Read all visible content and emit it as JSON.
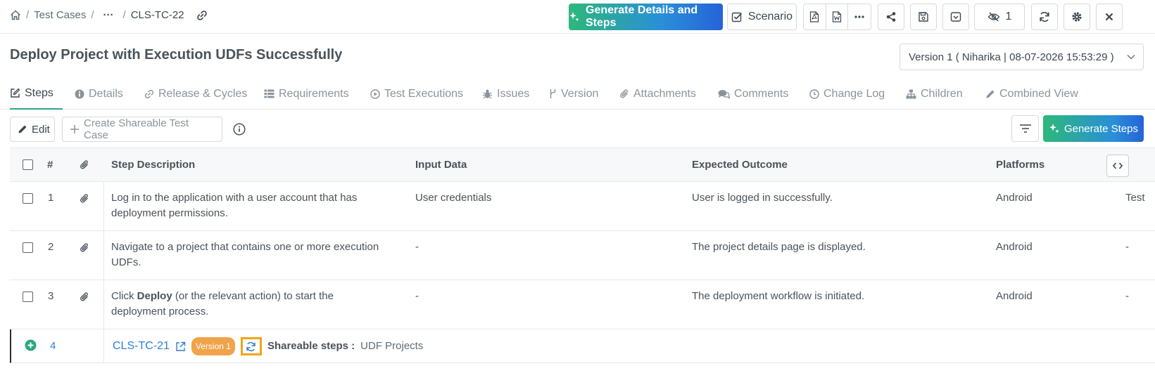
{
  "breadcrumb": {
    "items": [
      "Test Cases",
      "CLS-TC-22"
    ],
    "separator": "/",
    "ellipsis": "···"
  },
  "header": {
    "generate_label": "Generate Details and Steps",
    "scenario_label": "Scenario",
    "watch_count": "1"
  },
  "page": {
    "title": "Deploy Project with Execution UDFs Successfully",
    "version_selected": "Version 1 ( Niharika | 08-07-2026 15:53:29 )"
  },
  "tabs": [
    {
      "label": "Steps",
      "icon": "edit-icon"
    },
    {
      "label": "Details",
      "icon": "info-icon"
    },
    {
      "label": "Release & Cycles",
      "icon": "link-icon"
    },
    {
      "label": "Requirements",
      "icon": "list-icon"
    },
    {
      "label": "Test Executions",
      "icon": "play-icon"
    },
    {
      "label": "Issues",
      "icon": "bug-icon"
    },
    {
      "label": "Version",
      "icon": "branch-icon"
    },
    {
      "label": "Attachments",
      "icon": "paperclip-icon"
    },
    {
      "label": "Comments",
      "icon": "comments-icon"
    },
    {
      "label": "Change Log",
      "icon": "clock-icon"
    },
    {
      "label": "Children",
      "icon": "hierarchy-icon"
    },
    {
      "label": "Combined View",
      "icon": "pencil-icon"
    }
  ],
  "toolbar": {
    "edit_label": "Edit",
    "create_shareable_label": "Create Shareable Test Case",
    "generate_steps_label": "Generate Steps"
  },
  "table": {
    "headers": {
      "num": "#",
      "step_description": "Step Description",
      "input_data": "Input Data",
      "expected_outcome": "Expected Outcome",
      "platforms": "Platforms"
    },
    "rows": [
      {
        "num": "1",
        "desc_line1": "Log in to the application with a user account that has",
        "desc_line2": "deployment permissions.",
        "input": "User credentials",
        "outcome": "User is logged in successfully.",
        "platform": "Android",
        "extra": "Test"
      },
      {
        "num": "2",
        "desc_line1": "Navigate to a project that contains one or more execution",
        "desc_line2": "UDFs.",
        "input": "-",
        "outcome": "The project details page is displayed.",
        "platform": "Android",
        "extra": "-"
      },
      {
        "num": "3",
        "desc_pre": "Click ",
        "desc_bold": "Deploy",
        "desc_post": " (or the relevant action) to start the",
        "desc_line2": "deployment process.",
        "input": "-",
        "outcome": "The deployment workflow is initiated.",
        "platform": "Android",
        "extra": "-"
      }
    ],
    "shared_row": {
      "num": "4",
      "ref": "CLS-TC-21",
      "version_badge": "Version 1",
      "label": "Shareable steps :",
      "value": "UDF Projects"
    }
  }
}
